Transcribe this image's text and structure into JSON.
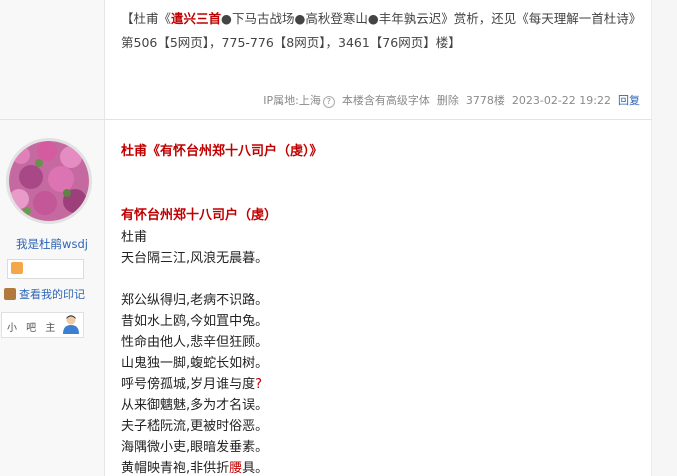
{
  "previous_post": {
    "text_parts": [
      "【杜甫《",
      "遣兴三首",
      "●下马古战场●高秋登寒山●丰年孰云迟》赏析，还见《每天理解一首杜诗》第506【5网页】，775-776【8网页】，3461【76网页】楼】"
    ],
    "meta": {
      "ip": "IP属地:上海",
      "font_notice": "本楼含有高级字体",
      "delete": "删除",
      "floor": "3778楼",
      "time": "2023-02-22 19:22",
      "reply": "回复"
    }
  },
  "user": {
    "name": "我是杜鹃wsdj",
    "imprint_link": "查看我的印记",
    "role": "小 吧 主"
  },
  "post": {
    "heading": "杜甫《有怀台州郑十八司户（虔）》",
    "title": "有怀台州郑十八司户（虔）",
    "author": "杜甫",
    "lines": [
      "天台隔三江,风浪无晨暮。",
      "郑公纵得归,老病不识路。",
      "昔如水上鸥,今如罝中兔。",
      "性命由他人,悲辛但狂顾。",
      "山鬼独一脚,蝮蛇长如树。",
      "呼号傍孤城,岁月谁与度",
      "从来御魑魅,多为才名误。",
      "夫子嵇阮流,更被时俗恶。",
      "海隅微小吏,眼暗发垂素。",
      "黄帽映青袍,非供折",
      "具。"
    ],
    "red_marks": [
      "?",
      "腰"
    ]
  },
  "colors": {
    "accent_red": "#c00000",
    "link_blue": "#2d64b3"
  }
}
